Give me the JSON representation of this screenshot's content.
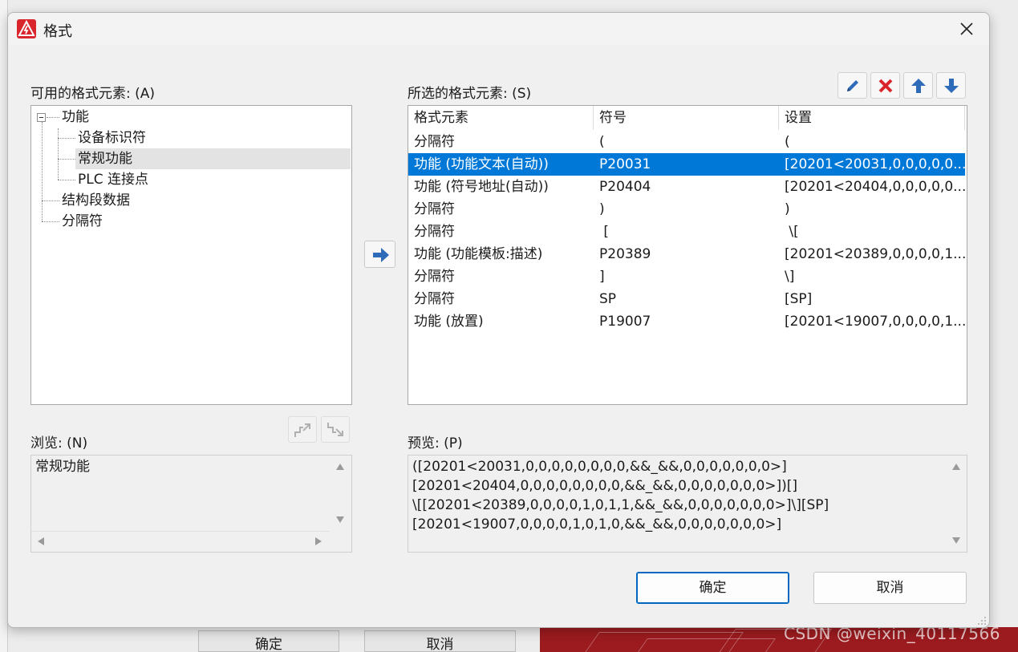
{
  "dialog": {
    "title": "格式",
    "available_label": "可用的格式元素: (A)",
    "selected_label": "所选的格式元素: (S)",
    "browse_label": "浏览: (N)",
    "preview_label": "预览: (P)",
    "ok_label": "确定",
    "cancel_label": "取消"
  },
  "tree": {
    "root": "功能",
    "children": [
      "设备标识符",
      "常规功能",
      "PLC 连接点"
    ],
    "siblings": [
      "结构段数据",
      "分隔符"
    ],
    "selected": "常规功能"
  },
  "table": {
    "headers": [
      "格式元素",
      "符号",
      "设置"
    ],
    "rows": [
      {
        "element": "分隔符",
        "symbol": "(",
        "setting": "("
      },
      {
        "element": "功能 (功能文本(自动))",
        "symbol": "P20031",
        "setting": "[20201<20031,0,0,0,0,0..."
      },
      {
        "element": "功能 (符号地址(自动))",
        "symbol": "P20404",
        "setting": "[20201<20404,0,0,0,0,0..."
      },
      {
        "element": "分隔符",
        "symbol": ")",
        "setting": ")"
      },
      {
        "element": "分隔符",
        "symbol": " [",
        "setting": " \\["
      },
      {
        "element": "功能 (功能模板:描述)",
        "symbol": "P20389",
        "setting": "[20201<20389,0,0,0,0,1..."
      },
      {
        "element": "分隔符",
        "symbol": "]",
        "setting": "\\]"
      },
      {
        "element": "分隔符",
        "symbol": "SP",
        "setting": "[SP]"
      },
      {
        "element": "功能 (放置)",
        "symbol": "P19007",
        "setting": "[20201<19007,0,0,0,0,1..."
      }
    ],
    "selected_row": 1
  },
  "browse": {
    "value": "常规功能"
  },
  "preview": {
    "lines": [
      "([20201<20031,0,0,0,0,0,0,0,0,&&_&&,0,0,0,0,0,0,0>]",
      "[20201<20404,0,0,0,0,0,0,0,0,&&_&&,0,0,0,0,0,0,0>])[]",
      "\\[[20201<20389,0,0,0,0,1,0,1,1,&&_&&,0,0,0,0,0,0,0>]\\][SP]",
      "[20201<19007,0,0,0,0,1,0,1,0,&&_&&,0,0,0,0,0,0,0>]"
    ]
  },
  "background": {
    "ok_label": "确定",
    "cancel_label": "取消",
    "watermark": "CSDN @weixin_40117566"
  },
  "colors": {
    "selection": "#0078d7",
    "delete_red": "#d9262c",
    "arrow_blue": "#2e6bb8",
    "primary_border": "#0067c0"
  },
  "icons": [
    "app-logo-icon",
    "close-icon",
    "edit-pencil-icon",
    "delete-x-icon",
    "move-up-arrow-icon",
    "move-down-arrow-icon",
    "add-right-arrow-icon",
    "move-up-stair-icon",
    "move-down-stair-icon"
  ]
}
